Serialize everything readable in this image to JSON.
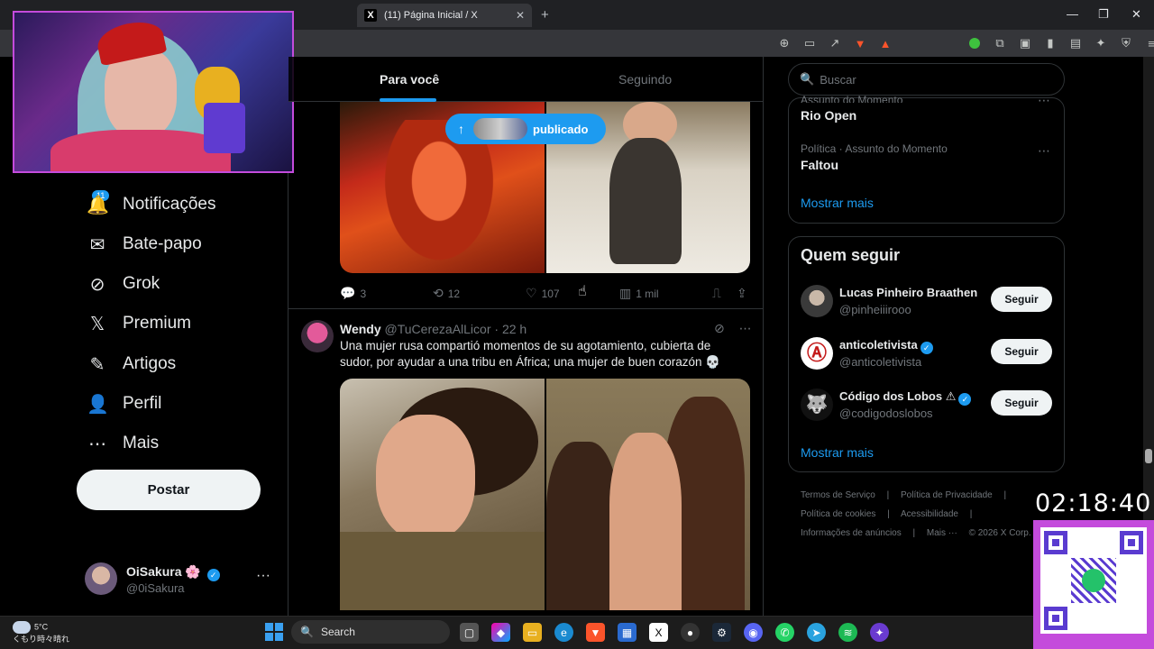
{
  "browser": {
    "tab_title": "(11) Página Inicial / X",
    "tab_close": "✕",
    "new_tab": "+",
    "minimize": "—",
    "maximize": "❐",
    "close": "✕",
    "addr_icons": [
      "zoom-icon",
      "cast-icon",
      "share-icon",
      "brave-icon",
      "rewards-icon",
      "extension-icon",
      "puzzle-icon",
      "tab-icon",
      "sidebar-icon",
      "wallet-icon",
      "leo-icon",
      "vpn-icon",
      "menu-icon"
    ]
  },
  "nav": {
    "notifications_badge": "11",
    "items": [
      {
        "label": "Notificações",
        "icon": "bell-icon",
        "glyph": "🔔"
      },
      {
        "label": "Bate-papo",
        "icon": "mail-icon",
        "glyph": "✉"
      },
      {
        "label": "Grok",
        "icon": "grok-icon",
        "glyph": "⊘"
      },
      {
        "label": "Premium",
        "icon": "x-logo-icon",
        "glyph": "𝕏"
      },
      {
        "label": "Artigos",
        "icon": "articles-icon",
        "glyph": "✎"
      },
      {
        "label": "Perfil",
        "icon": "person-icon",
        "glyph": "👤"
      },
      {
        "label": "Mais",
        "icon": "more-circle-icon",
        "glyph": "⋯"
      }
    ],
    "post_label": "Postar",
    "profile": {
      "name": "OiSakura",
      "flower": "🌸",
      "handle": "@0iSakura",
      "more": "···"
    }
  },
  "timeline": {
    "tabs": [
      {
        "label": "Para você"
      },
      {
        "label": "Seguindo"
      }
    ],
    "published_pill": "publicado",
    "tweet1_actions": {
      "replies": "3",
      "retweets": "12",
      "likes": "107",
      "views": "1 mil"
    },
    "tweet2": {
      "name": "Wendy",
      "handle": "@TuCerezaAlLicor",
      "time": "· 22 h",
      "text": "Una mujer rusa compartió momentos de su agotamiento, cubierta de sudor, por ayudar a una tribu en África; una mujer de buen corazón 💀"
    }
  },
  "right": {
    "search_placeholder": "Buscar",
    "trends": [
      {
        "context": "Assunto do Momento",
        "name": "Rio Open"
      },
      {
        "context": "Política · Assunto do Momento",
        "name": "Faltou"
      }
    ],
    "trends_more": "Mostrar mais",
    "who_to_follow_title": "Quem seguir",
    "follow": [
      {
        "name": "Lucas Pinheiro Braathen",
        "handle": "@pinheiiirooo",
        "button": "Seguir",
        "verified": false,
        "color": "#4a4a4a"
      },
      {
        "name": "anticoletivista",
        "handle": "@anticoletivista",
        "button": "Seguir",
        "verified": true,
        "color": "#ffffff"
      },
      {
        "name": "Código dos Lobos ⚠",
        "handle": "@codigodoslobos",
        "button": "Seguir",
        "verified": true,
        "color": "#1a1a1a"
      }
    ],
    "follow_more": "Mostrar mais",
    "footer": [
      "Termos de Serviço",
      "|",
      "Política de Privacidade",
      "|",
      "Política de cookies",
      "|",
      "Acessibilidade",
      "|",
      "Informações de anúncios",
      "|",
      "Mais ···",
      "© 2026 X Corp."
    ]
  },
  "overlay": {
    "clock": "02:18:40"
  },
  "taskbar": {
    "weather_temp": "5°C",
    "weather_desc": "くもり時々晴れ",
    "weather_badge": "3",
    "search_label": "Search"
  },
  "colors": {
    "accent": "#1d9bf0",
    "stream_frame": "#c44bdc",
    "muted": "#71767b"
  }
}
